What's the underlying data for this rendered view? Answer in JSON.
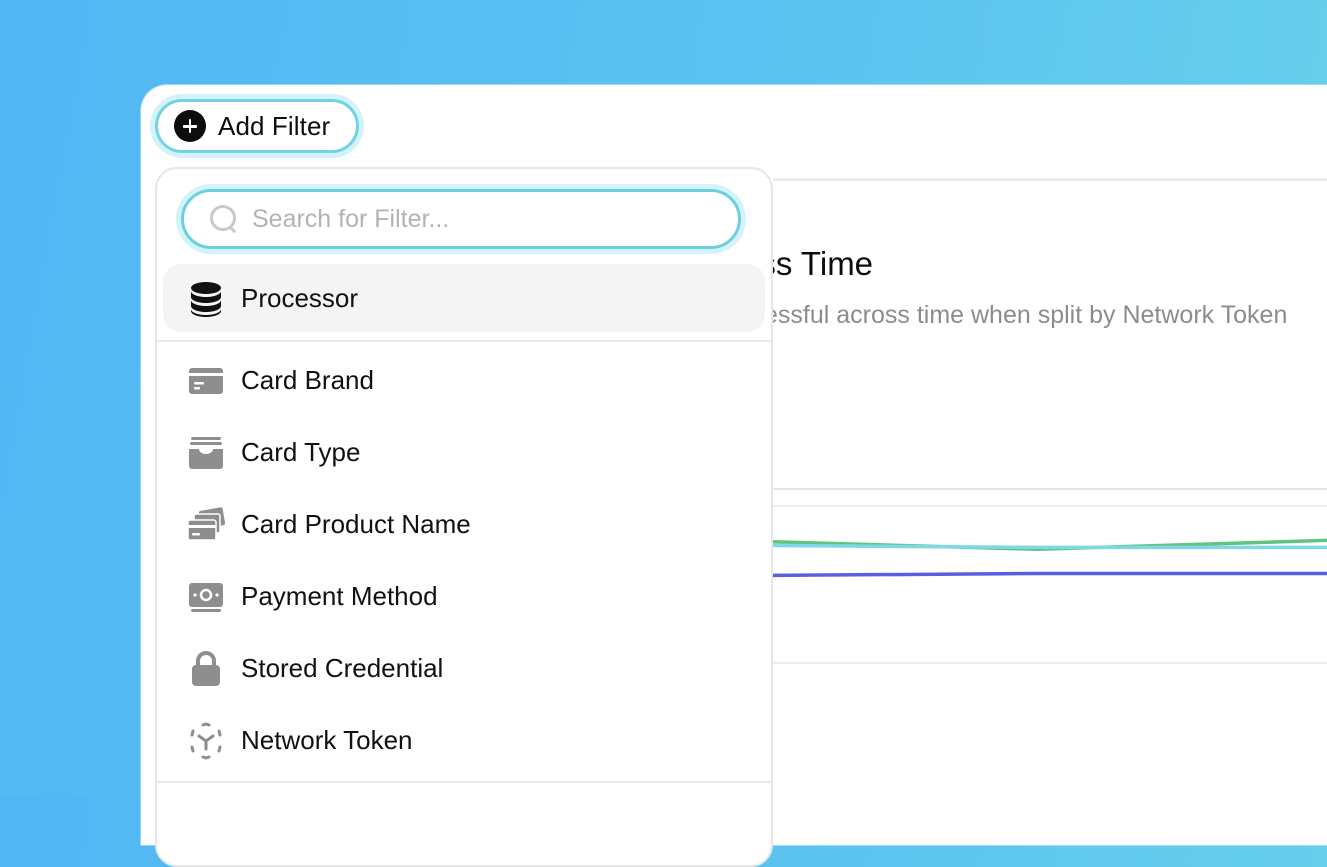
{
  "filter_button": {
    "label": "Add Filter"
  },
  "search": {
    "placeholder": "Search for Filter..."
  },
  "filter_options": [
    {
      "label": "Processor",
      "icon": "database-icon",
      "active": true
    },
    {
      "label": "Card Brand",
      "icon": "credit-card-icon"
    },
    {
      "label": "Card Type",
      "icon": "wallet-icon"
    },
    {
      "label": "Card Product Name",
      "icon": "cards-stack-icon"
    },
    {
      "label": "Payment Method",
      "icon": "banknote-icon"
    },
    {
      "label": "Stored Credential",
      "icon": "lock-icon"
    },
    {
      "label": "Network Token",
      "icon": "scan-token-icon"
    }
  ],
  "card": {
    "title_partial": "oss Time",
    "subtitle_partial": "essful across time when split by Network Token"
  },
  "chart_data": {
    "type": "line",
    "series": [
      {
        "color": "#5fc47c",
        "values": [
          0.86,
          0.82,
          0.87
        ]
      },
      {
        "color": "#7fd8e8",
        "values": [
          0.84,
          0.83,
          0.83
        ]
      },
      {
        "color": "#5a5fe0",
        "values": [
          0.68,
          0.69,
          0.69
        ]
      }
    ]
  },
  "colors": {
    "accent_ring": "#72d3e3",
    "active_row": "#f4f4f4"
  }
}
